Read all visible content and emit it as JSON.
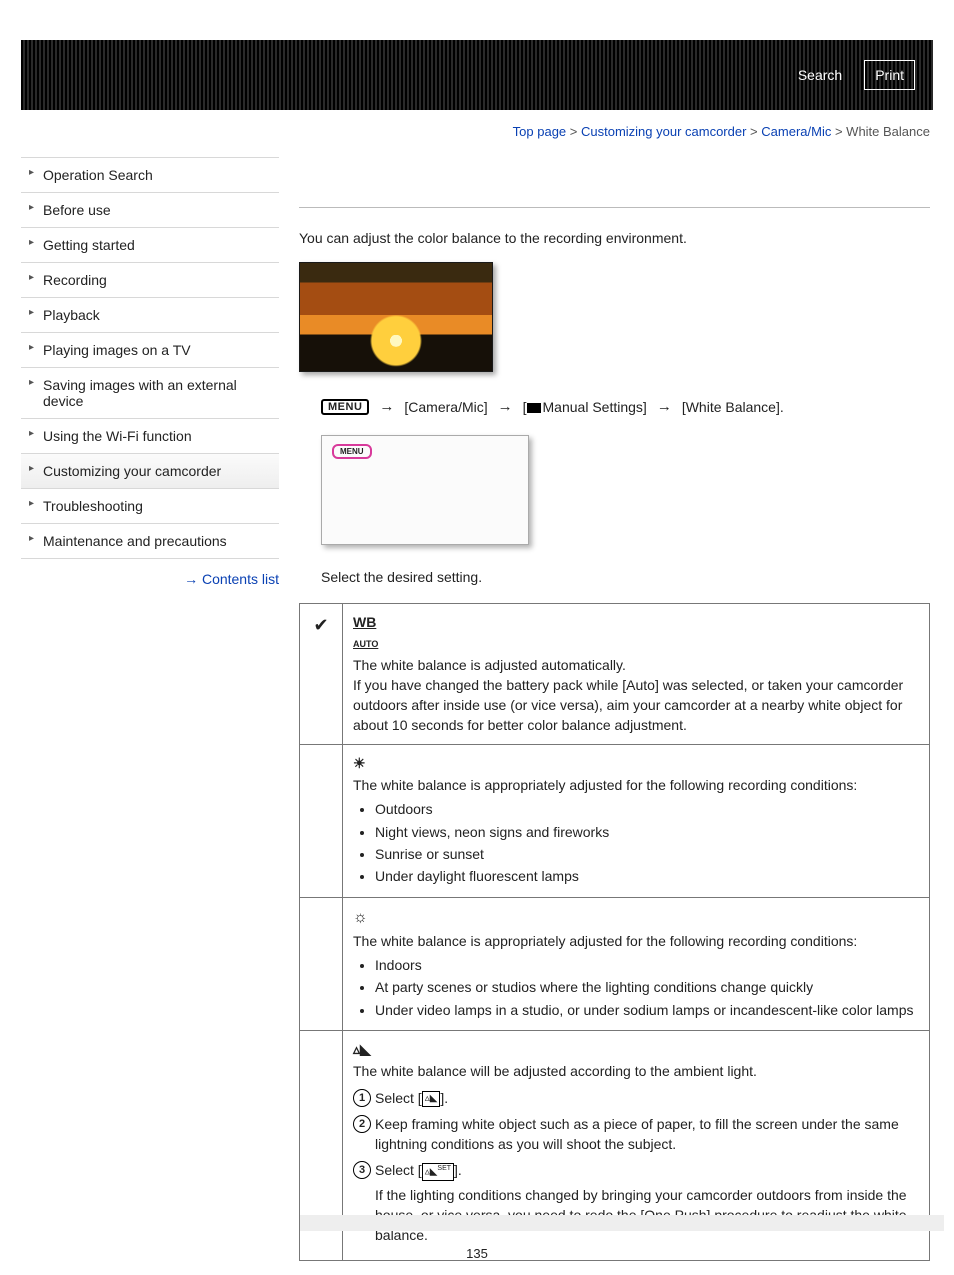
{
  "header": {
    "search": "Search",
    "print": "Print"
  },
  "breadcrumb": {
    "top": "Top page",
    "b1": "Customizing your camcorder",
    "b2": "Camera/Mic",
    "b3": "White Balance",
    "sep": " > "
  },
  "nav": {
    "items": [
      "Operation Search",
      "Before use",
      "Getting started",
      "Recording",
      "Playback",
      "Playing images on a TV",
      "Saving images with an external device",
      "Using the Wi-Fi function",
      "Customizing your camcorder",
      "Troubleshooting",
      "Maintenance and precautions"
    ],
    "active_index": 8,
    "contents": "Contents list"
  },
  "content": {
    "intro": "You can adjust the color balance to the recording environment.",
    "menu_label": "MENU",
    "path_camera": "[Camera/Mic]",
    "path_manual": "Manual Settings]",
    "path_manual_prefix": "[",
    "path_wb": "[White Balance].",
    "screen_tag": "MENU",
    "select": "Select the desired setting.",
    "options": {
      "auto": {
        "icon": "WB AUTO",
        "text": "The white balance is adjusted automatically.\nIf you have changed the battery pack while [Auto] was selected, or taken your camcorder outdoors after inside use (or vice versa), aim your camcorder at a nearby white object for about 10 seconds for better color balance adjustment."
      },
      "outdoor": {
        "lead": "The white balance is appropriately adjusted for the following recording conditions:",
        "items": [
          "Outdoors",
          "Night views, neon signs and fireworks",
          "Sunrise or sunset",
          "Under daylight fluorescent lamps"
        ]
      },
      "indoor": {
        "lead": "The white balance is appropriately adjusted for the following recording conditions:",
        "items": [
          "Indoors",
          "At party scenes or studios where the lighting conditions change quickly",
          "Under video lamps in a studio, or under sodium lamps or incandescent-like color lamps"
        ]
      },
      "onepush": {
        "lead": "The white balance will be adjusted according to the ambient light.",
        "step1a": "Select [",
        "step1b": "].",
        "step2": "Keep framing white object such as a piece of paper, to fill the screen under the same lightning conditions as you will shoot the subject.",
        "step3a": "Select [",
        "step3b": "].",
        "step3note": "If the lighting conditions changed by bringing your camcorder outdoors from inside the house, or vice versa, you need to redo the [One Push] procedure to readjust the white balance."
      }
    }
  },
  "page_number": "135"
}
